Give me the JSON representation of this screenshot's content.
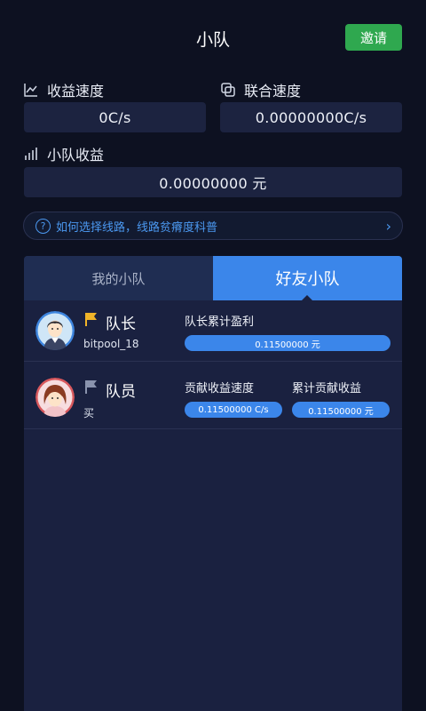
{
  "header": {
    "title": "小队",
    "invite_label": "邀请"
  },
  "stats": {
    "earn_speed_label": "收益速度",
    "earn_speed_value": "0C/s",
    "joint_speed_label": "联合速度",
    "joint_speed_value": "0.00000000C/s",
    "team_income_label": "小队收益",
    "team_income_value": "0.00000000 元"
  },
  "tip": {
    "text": "如何选择线路，线路贫瘠度科普",
    "chevron": "›"
  },
  "tabs": [
    {
      "label": "我的小队",
      "active": false
    },
    {
      "label": "好友小队",
      "active": true
    }
  ],
  "members": [
    {
      "role": "队长",
      "username": "bitpool_18",
      "metric1_label": "队长累计盈利",
      "metric1_value": "0.11500000 元"
    },
    {
      "role": "队员",
      "username": "买",
      "metric1_label": "贡献收益速度",
      "metric1_value": "0.11500000 C/s",
      "metric2_label": "累计贡献收益",
      "metric2_value": "0.11500000 元"
    }
  ],
  "colors": {
    "background": "#0d1121",
    "accent": "#3b86ea",
    "invite": "#2fa84f",
    "leader_flag": "#f0b429",
    "member_flag": "#8a93ad"
  }
}
